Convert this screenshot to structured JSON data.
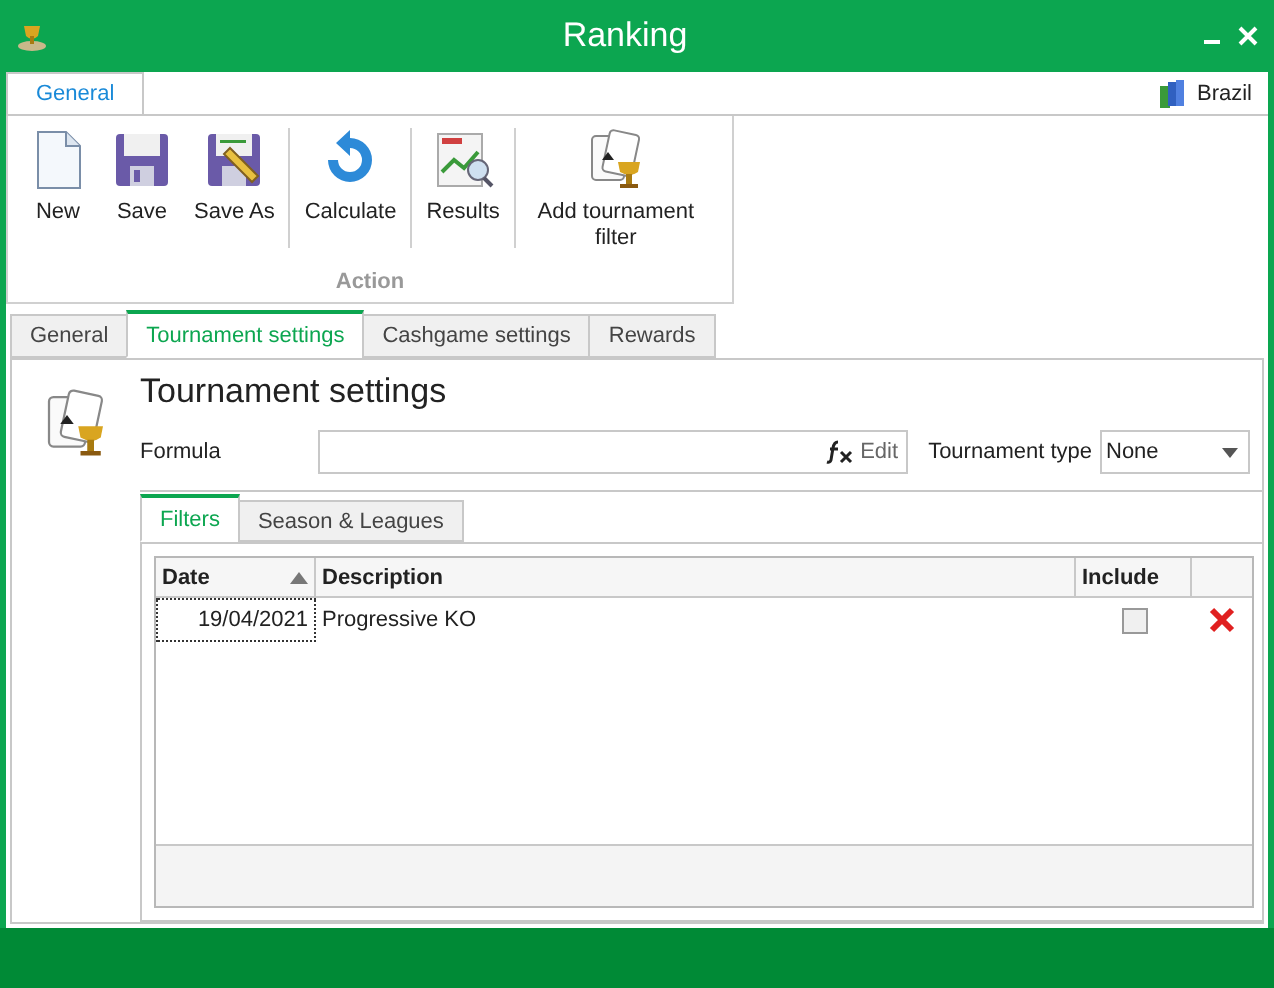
{
  "window": {
    "title": "Ranking"
  },
  "ribbon": {
    "tabs": [
      {
        "label": "General",
        "selected": true
      }
    ],
    "region": "Brazil",
    "buttons": [
      {
        "label": "New",
        "kind": "new"
      },
      {
        "label": "Save",
        "kind": "save"
      },
      {
        "label": "Save As",
        "kind": "saveas"
      },
      {
        "label": "Calculate",
        "kind": "calculate"
      },
      {
        "label": "Results",
        "kind": "results"
      },
      {
        "label": "Add tournament filter",
        "kind": "filter"
      }
    ],
    "group_label": "Action"
  },
  "tabs": [
    {
      "label": "General",
      "selected": false
    },
    {
      "label": "Tournament settings",
      "selected": true
    },
    {
      "label": "Cashgame settings",
      "selected": false
    },
    {
      "label": "Rewards",
      "selected": false
    }
  ],
  "page": {
    "title": "Tournament settings",
    "formula_label": "Formula",
    "formula_button": "Edit",
    "type_label": "Tournament type",
    "type_value": "None",
    "inner_tabs": [
      {
        "label": "Filters",
        "selected": true
      },
      {
        "label": "Season & Leagues",
        "selected": false
      }
    ],
    "table": {
      "columns": [
        {
          "label": "Date",
          "sorted": true
        },
        {
          "label": "Description",
          "sorted": false
        },
        {
          "label": "Include",
          "sorted": false
        }
      ],
      "rows": [
        {
          "date": "19/04/2021",
          "description": "Progressive KO",
          "include": false
        }
      ]
    }
  }
}
